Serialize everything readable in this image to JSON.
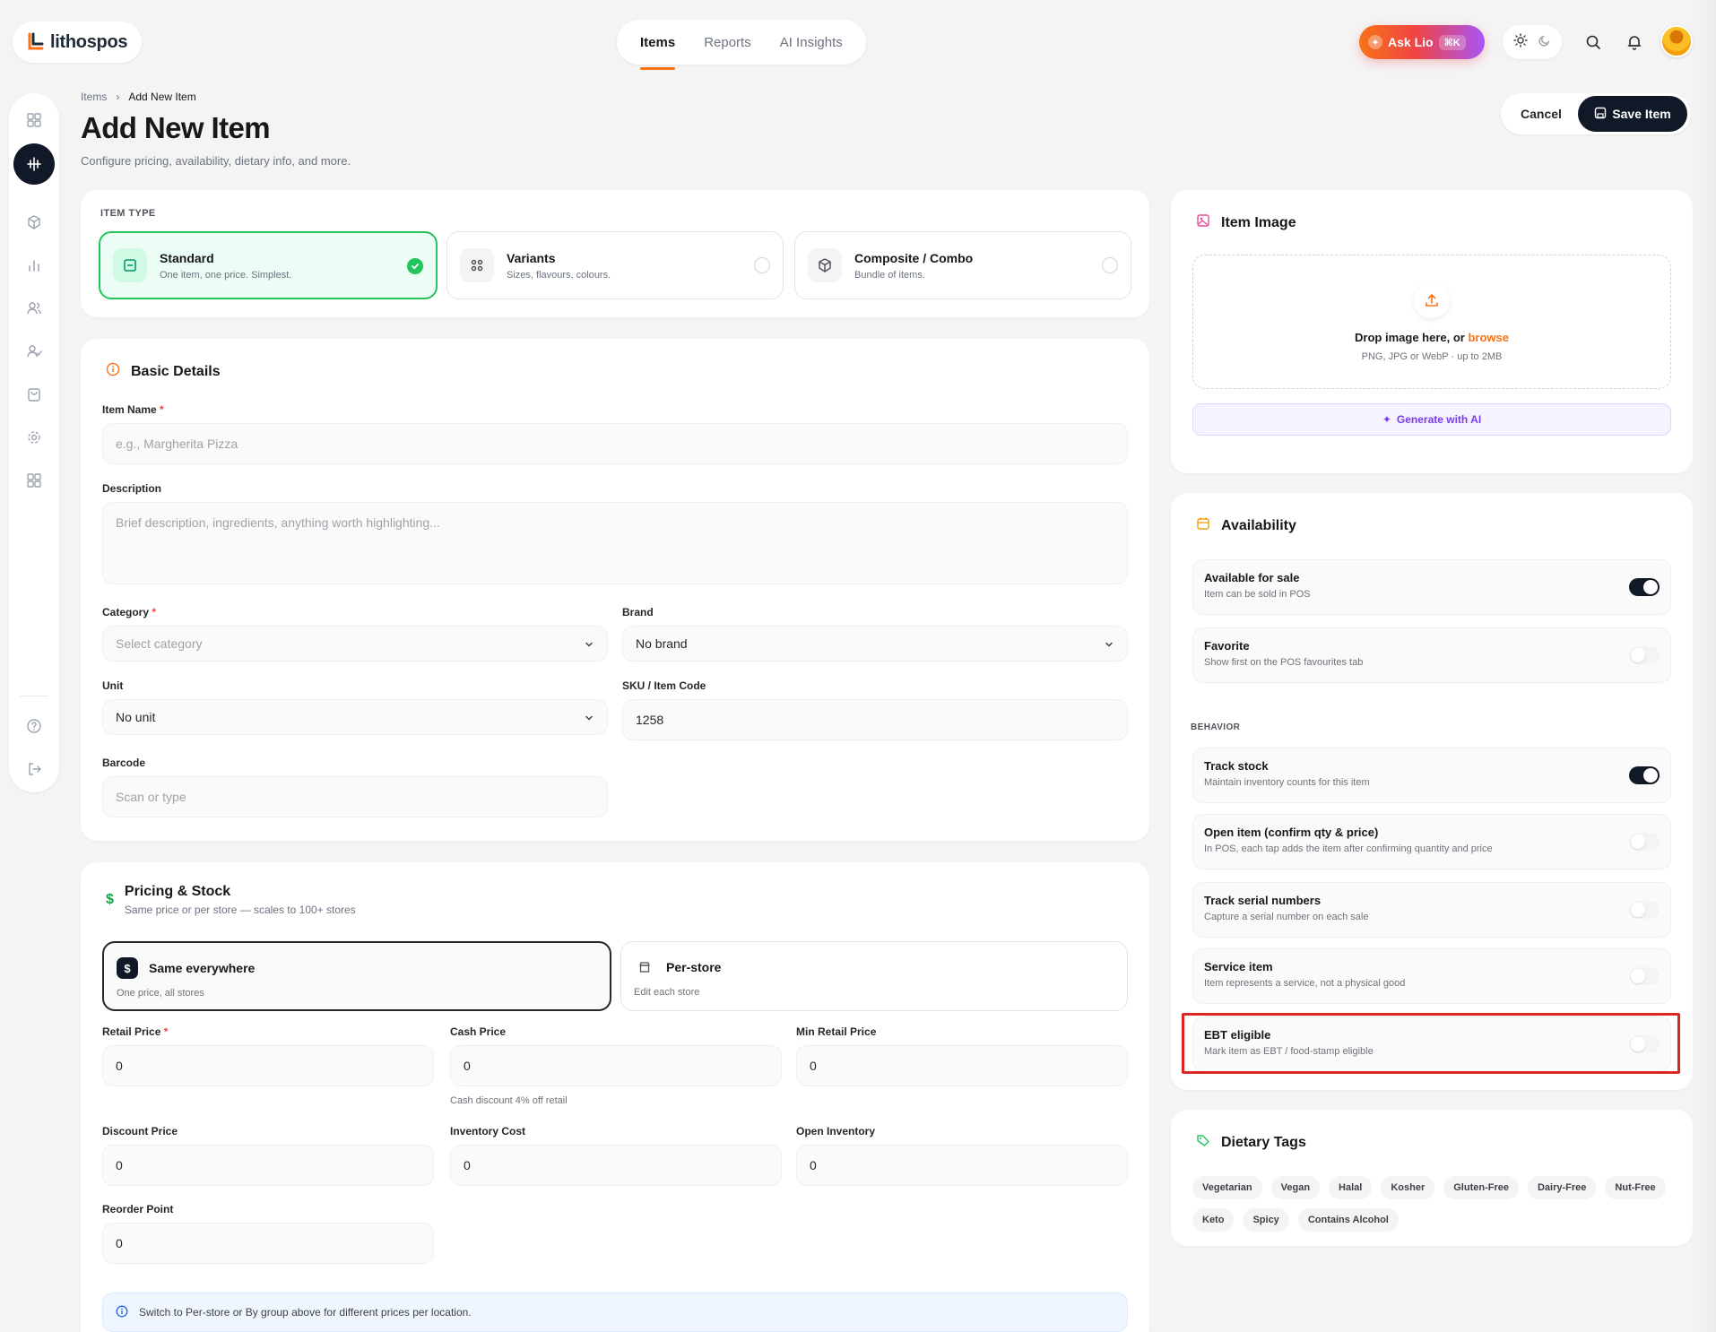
{
  "app": {
    "name": "lithospos"
  },
  "topnav": {
    "tabs": [
      "Items",
      "Reports",
      "AI Insights"
    ],
    "active": "Items"
  },
  "asklio": {
    "label": "Ask Lio",
    "kbd": "⌘K"
  },
  "breadcrumb": {
    "parent": "Items",
    "current": "Add New Item"
  },
  "page": {
    "title": "Add New Item",
    "subtitle": "Configure pricing, availability, dietary info, and more."
  },
  "actions": {
    "cancel": "Cancel",
    "save": "Save Item"
  },
  "item_type": {
    "label": "ITEM TYPE",
    "options": [
      {
        "title": "Standard",
        "sub": "One item, one price. Simplest.",
        "icon": "standard-icon",
        "selected": true
      },
      {
        "title": "Variants",
        "sub": "Sizes, flavours, colours.",
        "icon": "variants-icon",
        "selected": false
      },
      {
        "title": "Composite / Combo",
        "sub": "Bundle of items.",
        "icon": "box-icon",
        "selected": false
      }
    ]
  },
  "basic": {
    "title": "Basic Details",
    "item_name": {
      "label": "Item Name",
      "placeholder": "e.g., Margherita Pizza"
    },
    "description": {
      "label": "Description",
      "placeholder": "Brief description, ingredients, anything worth highlighting..."
    },
    "category": {
      "label": "Category",
      "placeholder": "Select category"
    },
    "brand": {
      "label": "Brand",
      "value": "No brand"
    },
    "unit": {
      "label": "Unit",
      "value": "No unit"
    },
    "sku": {
      "label": "SKU / Item Code",
      "value": "1258"
    },
    "barcode": {
      "label": "Barcode",
      "placeholder": "Scan or type"
    }
  },
  "pricing": {
    "title": "Pricing & Stock",
    "subtitle": "Same price or per store — scales to 100+ stores",
    "modes": [
      {
        "title": "Same everywhere",
        "sub": "One price, all stores",
        "icon": "$",
        "selected": true
      },
      {
        "title": "Per-store",
        "sub": "Edit each store",
        "icon": "store-icon",
        "selected": false
      }
    ],
    "retail": {
      "label": "Retail Price",
      "value": "0"
    },
    "cash": {
      "label": "Cash Price",
      "value": "0",
      "hint": "Cash discount 4% off retail"
    },
    "min_retail": {
      "label": "Min Retail Price",
      "value": "0"
    },
    "discount": {
      "label": "Discount Price",
      "value": "0"
    },
    "inventory_cost": {
      "label": "Inventory Cost",
      "value": "0"
    },
    "open_inventory": {
      "label": "Open Inventory",
      "value": "0"
    },
    "reorder": {
      "label": "Reorder Point",
      "value": "0"
    },
    "info": "Switch to Per-store or By group above for different prices per location."
  },
  "image": {
    "title": "Item Image",
    "drop_main": "Drop image here, or ",
    "drop_link": "browse",
    "drop_sub": "PNG, JPG or WebP · up to 2MB",
    "generate": "Generate with AI"
  },
  "availability": {
    "title": "Availability",
    "rows": [
      {
        "title": "Available for sale",
        "sub": "Item can be sold in POS",
        "on": true
      },
      {
        "title": "Favorite",
        "sub": "Show first on the POS favourites tab",
        "on": false
      }
    ],
    "behavior_label": "BEHAVIOR",
    "behavior": [
      {
        "title": "Track stock",
        "sub": "Maintain inventory counts for this item",
        "on": true
      },
      {
        "title": "Open item (confirm qty & price)",
        "sub": "In POS, each tap adds the item after confirming quantity and price",
        "on": false
      },
      {
        "title": "Track serial numbers",
        "sub": "Capture a serial number on each sale",
        "on": false
      },
      {
        "title": "Service item",
        "sub": "Item represents a service, not a physical good",
        "on": false
      },
      {
        "title": "EBT eligible",
        "sub": "Mark item as EBT / food-stamp eligible",
        "on": false
      }
    ]
  },
  "dietary": {
    "title": "Dietary Tags",
    "tags": [
      "Vegetarian",
      "Vegan",
      "Halal",
      "Kosher",
      "Gluten-Free",
      "Dairy-Free",
      "Nut-Free",
      "Keto",
      "Spicy",
      "Contains Alcohol"
    ]
  },
  "colors": {
    "accent": "#f97316",
    "selected": "#22c55e",
    "dark": "#111827",
    "highlight": "#dc2626"
  }
}
